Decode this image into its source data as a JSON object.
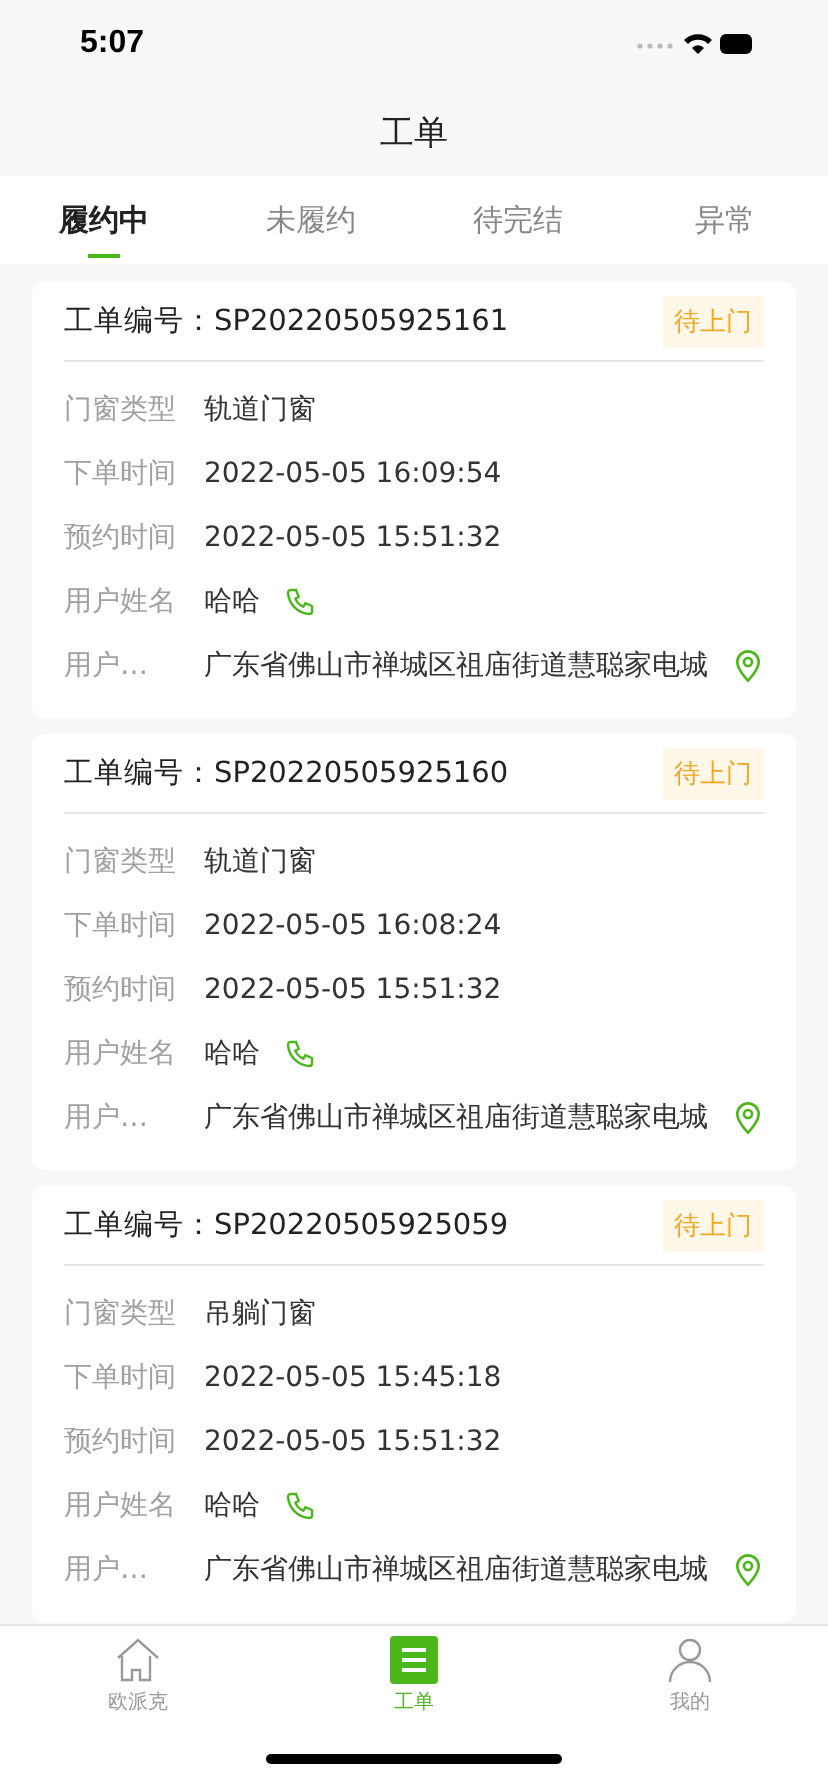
{
  "status_bar": {
    "time": "5:07"
  },
  "nav": {
    "title": "工单"
  },
  "tabs": [
    {
      "label": "履约中",
      "selected": true
    },
    {
      "label": "未履约",
      "selected": false
    },
    {
      "label": "待完结",
      "selected": false
    },
    {
      "label": "异常",
      "selected": false
    }
  ],
  "orders": [
    {
      "number_label": "工单编号：",
      "number": "SP20220505925161",
      "status": "待上门",
      "fields": [
        {
          "kind": "text",
          "label": "门窗类型",
          "value": "轨道门窗"
        },
        {
          "kind": "text",
          "label": "下单时间",
          "value": "2022-05-05 16:09:54"
        },
        {
          "kind": "text",
          "label": "预约时间",
          "value": "2022-05-05 15:51:32"
        },
        {
          "kind": "phone",
          "label": "用户姓名",
          "value": "哈哈"
        },
        {
          "kind": "address",
          "label": "用户…",
          "value": "广东省佛山市禅城区祖庙街道慧聪家电城"
        }
      ]
    },
    {
      "number_label": "工单编号：",
      "number": "SP20220505925160",
      "status": "待上门",
      "fields": [
        {
          "kind": "text",
          "label": "门窗类型",
          "value": "轨道门窗"
        },
        {
          "kind": "text",
          "label": "下单时间",
          "value": "2022-05-05 16:08:24"
        },
        {
          "kind": "text",
          "label": "预约时间",
          "value": "2022-05-05 15:51:32"
        },
        {
          "kind": "phone",
          "label": "用户姓名",
          "value": "哈哈"
        },
        {
          "kind": "address",
          "label": "用户…",
          "value": "广东省佛山市禅城区祖庙街道慧聪家电城"
        }
      ]
    },
    {
      "number_label": "工单编号：",
      "number": "SP20220505925059",
      "status": "待上门",
      "fields": [
        {
          "kind": "text",
          "label": "门窗类型",
          "value": "吊躺门窗"
        },
        {
          "kind": "text",
          "label": "下单时间",
          "value": "2022-05-05 15:45:18"
        },
        {
          "kind": "text",
          "label": "预约时间",
          "value": "2022-05-05 15:51:32"
        },
        {
          "kind": "phone",
          "label": "用户姓名",
          "value": "哈哈"
        },
        {
          "kind": "address",
          "label": "用户…",
          "value": "广东省佛山市禅城区祖庙街道慧聪家电城"
        }
      ]
    }
  ],
  "tab_bar": [
    {
      "kind": "home",
      "label": "欧派克",
      "selected": false
    },
    {
      "kind": "orders",
      "label": "工单",
      "selected": true
    },
    {
      "kind": "profile",
      "label": "我的",
      "selected": false
    }
  ]
}
